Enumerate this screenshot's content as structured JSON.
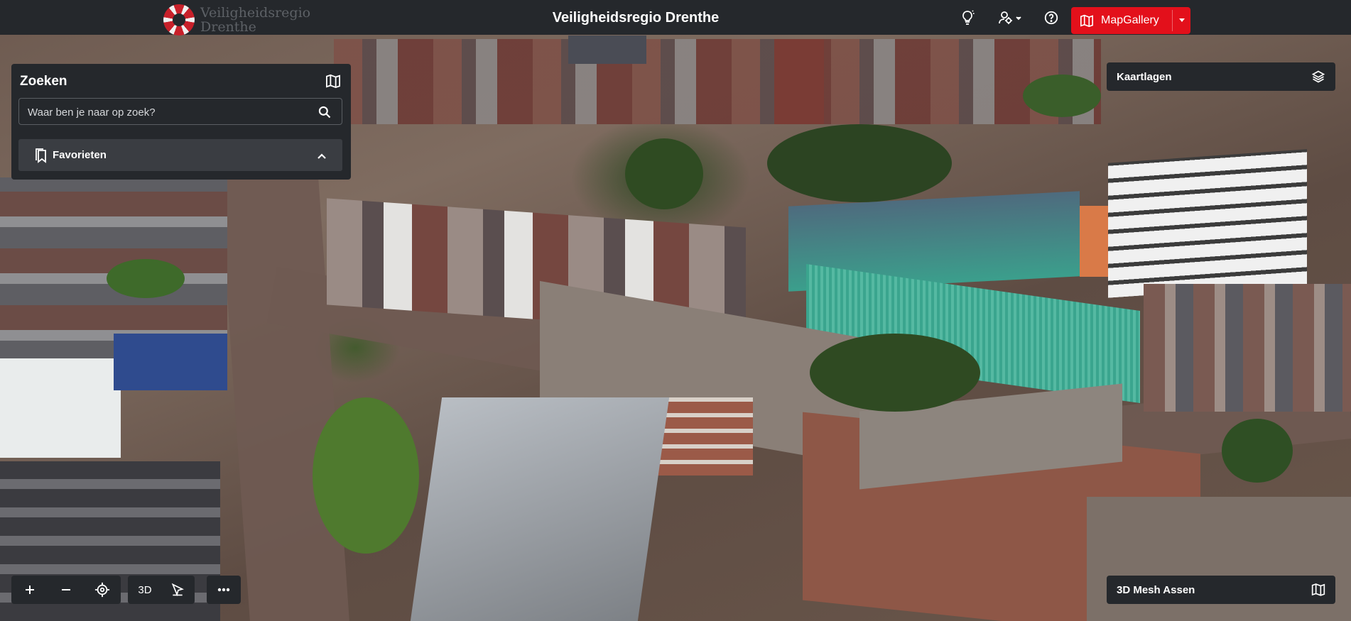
{
  "header": {
    "logo_text_line1": "Veiligheidsregio",
    "logo_text_line2": "Drenthe",
    "title": "Veiligheidsregio Drenthe",
    "icons": [
      "lightbulb-icon",
      "user-settings-icon",
      "help-icon"
    ],
    "mapgallery_label": "MapGallery",
    "accent_color": "#e3101b"
  },
  "search_panel": {
    "title": "Zoeken",
    "search_placeholder": "Waar ben je naar op zoek?",
    "favorites_label": "Favorieten"
  },
  "layers_panel": {
    "label": "Kaartlagen"
  },
  "basemap_panel": {
    "label": "3D Mesh Assen"
  },
  "map_controls": {
    "zoom_in": "+",
    "zoom_out": "−",
    "mode_3d_label": "3D"
  }
}
